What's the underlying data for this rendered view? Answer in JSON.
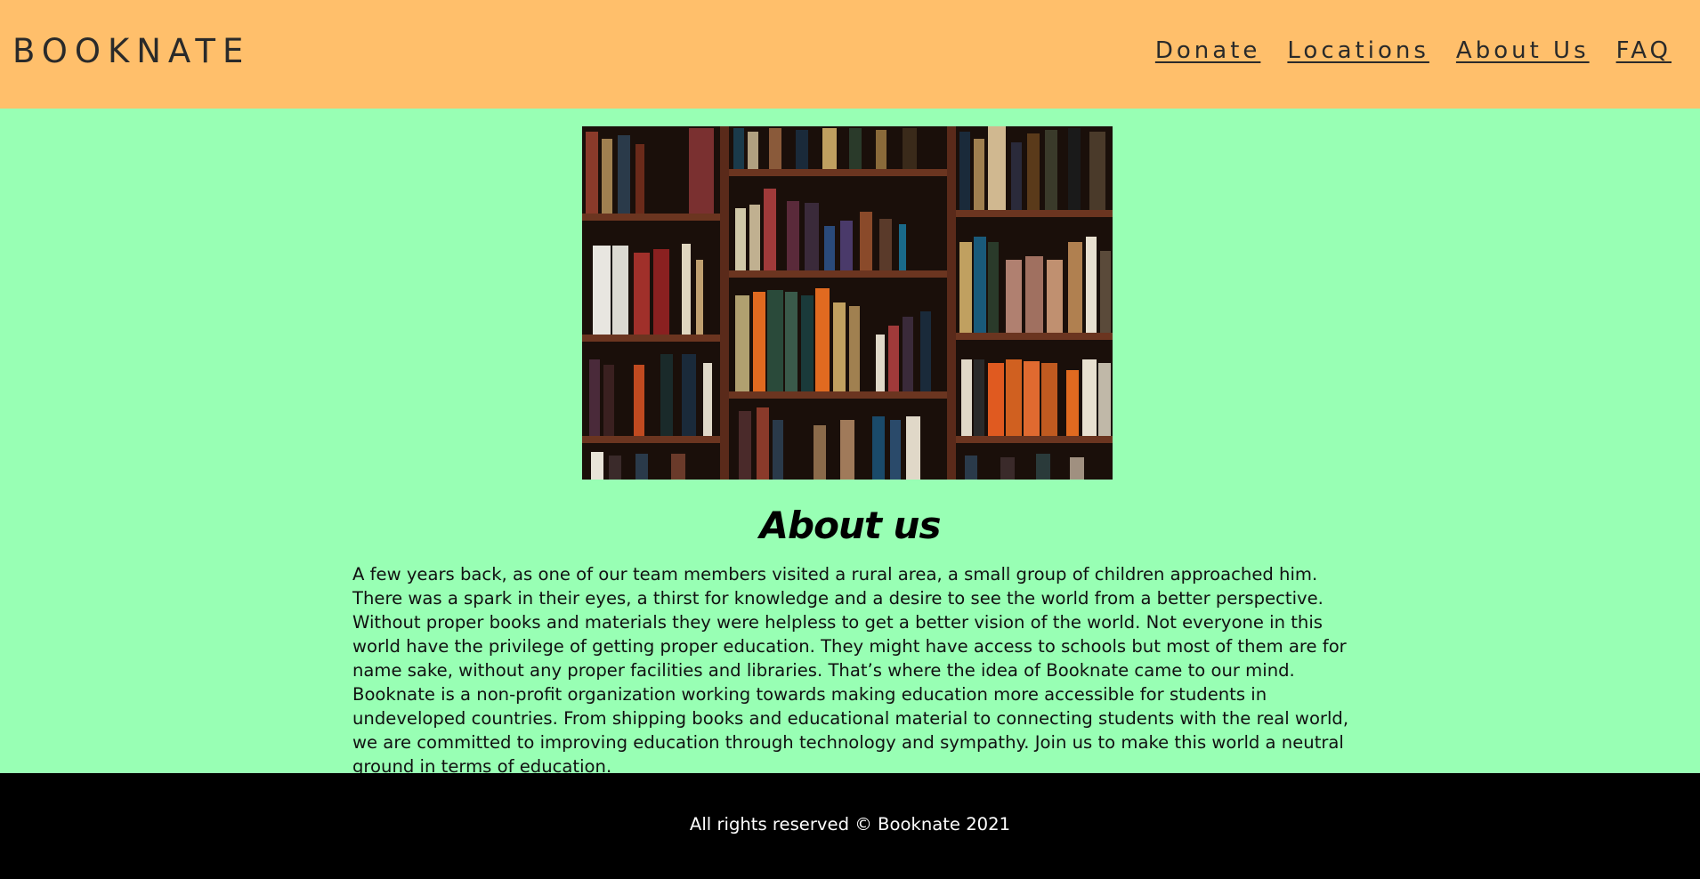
{
  "header": {
    "logo": "BOOKNATE",
    "nav": [
      {
        "label": "Donate"
      },
      {
        "label": "Locations"
      },
      {
        "label": "About Us"
      },
      {
        "label": "FAQ"
      }
    ]
  },
  "main": {
    "hero_image": "bookshelf-photo",
    "title": "About us",
    "paragraph": "A few years back, as one of our team members visited a rural area, a small group of children approached him. There was a spark in their eyes, a thirst for knowledge and a desire to see the world from a better perspective. Without proper books and materials they were helpless to get a better vision of the world. Not everyone in this world have the privilege of getting proper education. They might have access to schools but most of them are for name sake, without any proper facilities and libraries. That’s where the idea of Booknate came to our mind. Booknate is a non-profit organization working towards making education more accessible for students in undeveloped countries. From shipping books and educational material to connecting students with the real world, we are committed to improving education through technology and sympathy. Join us to make this world a neutral ground in terms of education."
  },
  "footer": {
    "text": "All rights reserved © Booknate 2021"
  },
  "colors": {
    "header_bg": "#ffbf6b",
    "page_bg": "#98ffb4",
    "footer_bg": "#000000"
  }
}
